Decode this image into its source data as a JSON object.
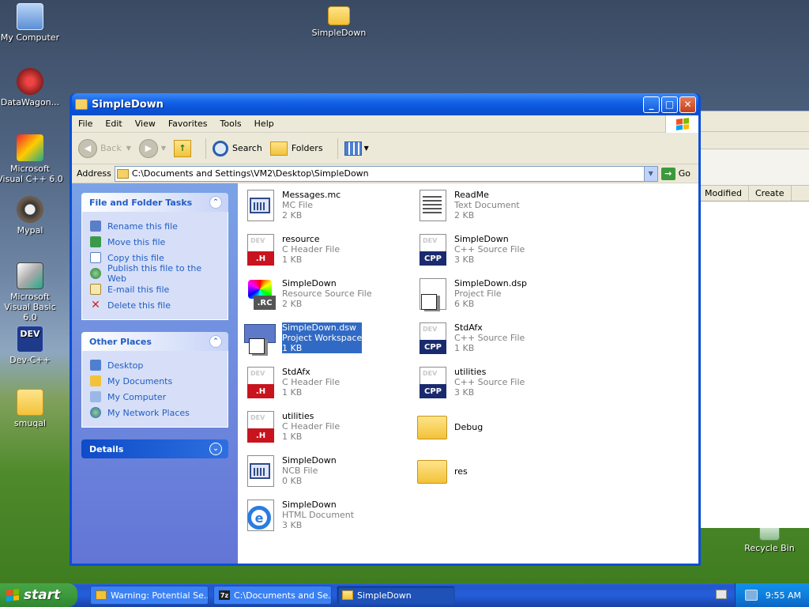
{
  "desktop": {
    "icons": [
      {
        "label": "My Computer"
      },
      {
        "label": "DataWagon..."
      },
      {
        "label": "Microsoft Visual C++ 6.0"
      },
      {
        "label": "Mypal"
      },
      {
        "label": "Microsoft Visual Basic 6.0"
      },
      {
        "label": "Dev-C++"
      },
      {
        "label": "smuqal"
      },
      {
        "label": "SimpleDown"
      },
      {
        "label": "Recycle Bin"
      }
    ]
  },
  "background_window": {
    "columns": [
      "Modified",
      "Create"
    ]
  },
  "window": {
    "title": "SimpleDown",
    "menu": [
      "File",
      "Edit",
      "View",
      "Favorites",
      "Tools",
      "Help"
    ],
    "toolbar": {
      "back": "Back",
      "search": "Search",
      "folders": "Folders"
    },
    "address": {
      "label": "Address",
      "value": "C:\\Documents and Settings\\VM2\\Desktop\\SimpleDown",
      "go": "Go"
    },
    "tasks": {
      "file_folder_title": "File and Folder Tasks",
      "file_folder_items": [
        "Rename this file",
        "Move this file",
        "Copy this file",
        "Publish this file to the Web",
        "E-mail this file",
        "Delete this file"
      ],
      "other_places_title": "Other Places",
      "other_places_items": [
        "Desktop",
        "My Documents",
        "My Computer",
        "My Network Places"
      ],
      "details_title": "Details"
    },
    "files": [
      {
        "name": "Messages.mc",
        "type": "MC File",
        "size": "2 KB"
      },
      {
        "name": "ReadMe",
        "type": "Text Document",
        "size": "2 KB"
      },
      {
        "name": "resource",
        "type": "C Header File",
        "size": "1 KB",
        "tag": ".H"
      },
      {
        "name": "SimpleDown",
        "type": "C++ Source File",
        "size": "3 KB",
        "tag": "CPP"
      },
      {
        "name": "SimpleDown",
        "type": "Resource Source File",
        "size": "2 KB",
        "tag": ".RC"
      },
      {
        "name": "SimpleDown.dsp",
        "type": "Project File",
        "size": "6 KB"
      },
      {
        "name": "SimpleDown.dsw",
        "type": "Project Workspace",
        "size": "1 KB"
      },
      {
        "name": "StdAfx",
        "type": "C++ Source File",
        "size": "1 KB",
        "tag": "CPP"
      },
      {
        "name": "StdAfx",
        "type": "C Header File",
        "size": "1 KB",
        "tag": ".H"
      },
      {
        "name": "utilities",
        "type": "C++ Source File",
        "size": "3 KB",
        "tag": "CPP"
      },
      {
        "name": "utilities",
        "type": "C Header File",
        "size": "1 KB",
        "tag": ".H"
      },
      {
        "name": "Debug"
      },
      {
        "name": "SimpleDown",
        "type": "NCB File",
        "size": "0 KB"
      },
      {
        "name": "res"
      },
      {
        "name": "SimpleDown",
        "type": "HTML Document",
        "size": "3 KB"
      }
    ],
    "dev_watermark": "DEV"
  },
  "taskbar": {
    "start": "start",
    "tasks": [
      "Warning: Potential Se...",
      "C:\\Documents and Se...",
      "SimpleDown"
    ],
    "task_badge": "7z",
    "clock": "9:55 AM"
  }
}
